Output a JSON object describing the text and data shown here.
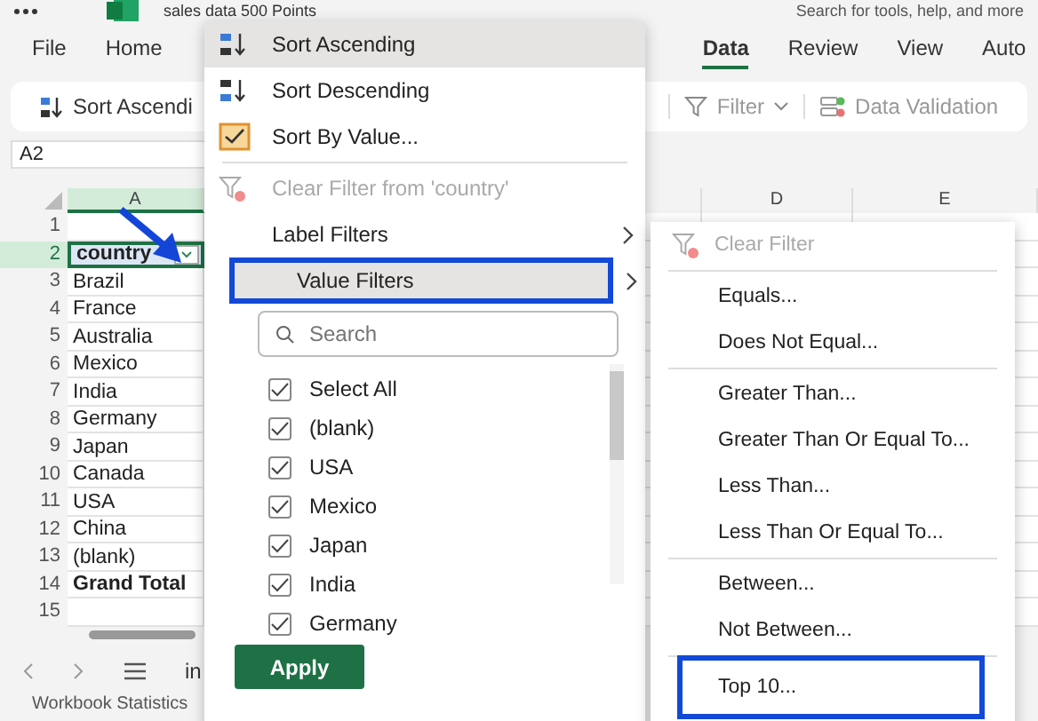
{
  "title_bar": {
    "file_name": "sales data 500 Points",
    "search": {
      "placeholder": "Search for tools, help, and more"
    }
  },
  "ribbon_tabs": [
    {
      "label": "File",
      "selected": false
    },
    {
      "label": "Home",
      "selected": false
    },
    {
      "label": "Data",
      "selected": true
    },
    {
      "label": "Review",
      "selected": false
    },
    {
      "label": "View",
      "selected": false
    },
    {
      "label": "Auto",
      "selected": false
    }
  ],
  "toolbar": [
    {
      "kind": "sort",
      "label": "Sort Ascendi"
    },
    {
      "kind": "filter",
      "label": "Filter"
    },
    {
      "kind": "validation",
      "label": "Data Validation"
    }
  ],
  "name_box": {
    "value": "A2"
  },
  "sheet": {
    "columns": [
      {
        "label": "A",
        "selected": true
      },
      {
        "label": "D",
        "selected": false
      },
      {
        "label": "E",
        "selected": false
      }
    ],
    "rows": [
      {
        "number": "1",
        "selected": false
      },
      {
        "number": "2",
        "cell": "country",
        "kind": "header",
        "selected": true
      },
      {
        "number": "3",
        "cell": "Brazil",
        "kind": "item",
        "selected": false
      },
      {
        "number": "4",
        "cell": "France",
        "kind": "item",
        "selected": false
      },
      {
        "number": "5",
        "cell": "Australia",
        "kind": "item",
        "selected": false
      },
      {
        "number": "6",
        "cell": "Mexico",
        "kind": "item",
        "selected": false
      },
      {
        "number": "7",
        "cell": "India",
        "kind": "item",
        "selected": false
      },
      {
        "number": "8",
        "cell": "Germany",
        "kind": "item",
        "selected": false
      },
      {
        "number": "9",
        "cell": "Japan",
        "kind": "item",
        "selected": false
      },
      {
        "number": "10",
        "cell": "Canada",
        "kind": "item",
        "selected": false
      },
      {
        "number": "11",
        "cell": "USA",
        "kind": "item",
        "selected": false
      },
      {
        "number": "12",
        "cell": "China",
        "kind": "item",
        "selected": false
      },
      {
        "number": "13",
        "cell": "(blank)",
        "kind": "item",
        "selected": false
      },
      {
        "number": "14",
        "cell": "Grand Total",
        "kind": "total",
        "selected": false
      },
      {
        "number": "15",
        "selected": false
      }
    ]
  },
  "sheet_nav": {
    "sheet_tab": "in"
  },
  "status_bar": {
    "text": "Workbook Statistics"
  },
  "filter_menu": {
    "items": [
      {
        "kind": "sort-asc",
        "label": "Sort Ascending",
        "highlighted": true,
        "outlined": false
      },
      {
        "kind": "sort-desc",
        "label": "Sort Descending",
        "highlighted": false,
        "outlined": false
      },
      {
        "kind": "check",
        "label": "Sort By Value...",
        "checked": true,
        "highlighted": false,
        "outlined": false
      },
      {
        "kind": "divider"
      },
      {
        "kind": "clear",
        "label": "Clear Filter from 'country'",
        "disabled": true,
        "highlighted": false,
        "outlined": false
      },
      {
        "kind": "submenu",
        "label": "Label Filters",
        "highlighted": false,
        "outlined": false
      },
      {
        "kind": "submenu",
        "label": "Value Filters",
        "highlighted": true,
        "outlined": true
      }
    ],
    "search": {
      "placeholder": "Search"
    },
    "values": [
      {
        "label": "Select All",
        "checked": true
      },
      {
        "label": "(blank)",
        "checked": true
      },
      {
        "label": "USA",
        "checked": true
      },
      {
        "label": "Mexico",
        "checked": true
      },
      {
        "label": "Japan",
        "checked": true
      },
      {
        "label": "India",
        "checked": true
      },
      {
        "label": "Germany",
        "checked": true
      }
    ],
    "apply_button": "Apply"
  },
  "value_filters_menu": {
    "items": [
      {
        "kind": "clear",
        "label": "Clear Filter",
        "disabled": true,
        "outlined": false
      },
      {
        "kind": "divider"
      },
      {
        "kind": "option",
        "label": "Equals...",
        "disabled": false,
        "outlined": false
      },
      {
        "kind": "option",
        "label": "Does Not Equal...",
        "disabled": false,
        "outlined": false
      },
      {
        "kind": "divider"
      },
      {
        "kind": "option",
        "label": "Greater Than...",
        "disabled": false,
        "outlined": false
      },
      {
        "kind": "option",
        "label": "Greater Than Or Equal To...",
        "disabled": false,
        "outlined": false
      },
      {
        "kind": "option",
        "label": "Less Than...",
        "disabled": false,
        "outlined": false
      },
      {
        "kind": "option",
        "label": "Less Than Or Equal To...",
        "disabled": false,
        "outlined": false
      },
      {
        "kind": "divider"
      },
      {
        "kind": "option",
        "label": "Between...",
        "disabled": false,
        "outlined": false
      },
      {
        "kind": "option",
        "label": "Not Between...",
        "disabled": false,
        "outlined": false
      },
      {
        "kind": "divider"
      },
      {
        "kind": "option",
        "label": "Top 10...",
        "disabled": false,
        "outlined": true
      }
    ]
  }
}
